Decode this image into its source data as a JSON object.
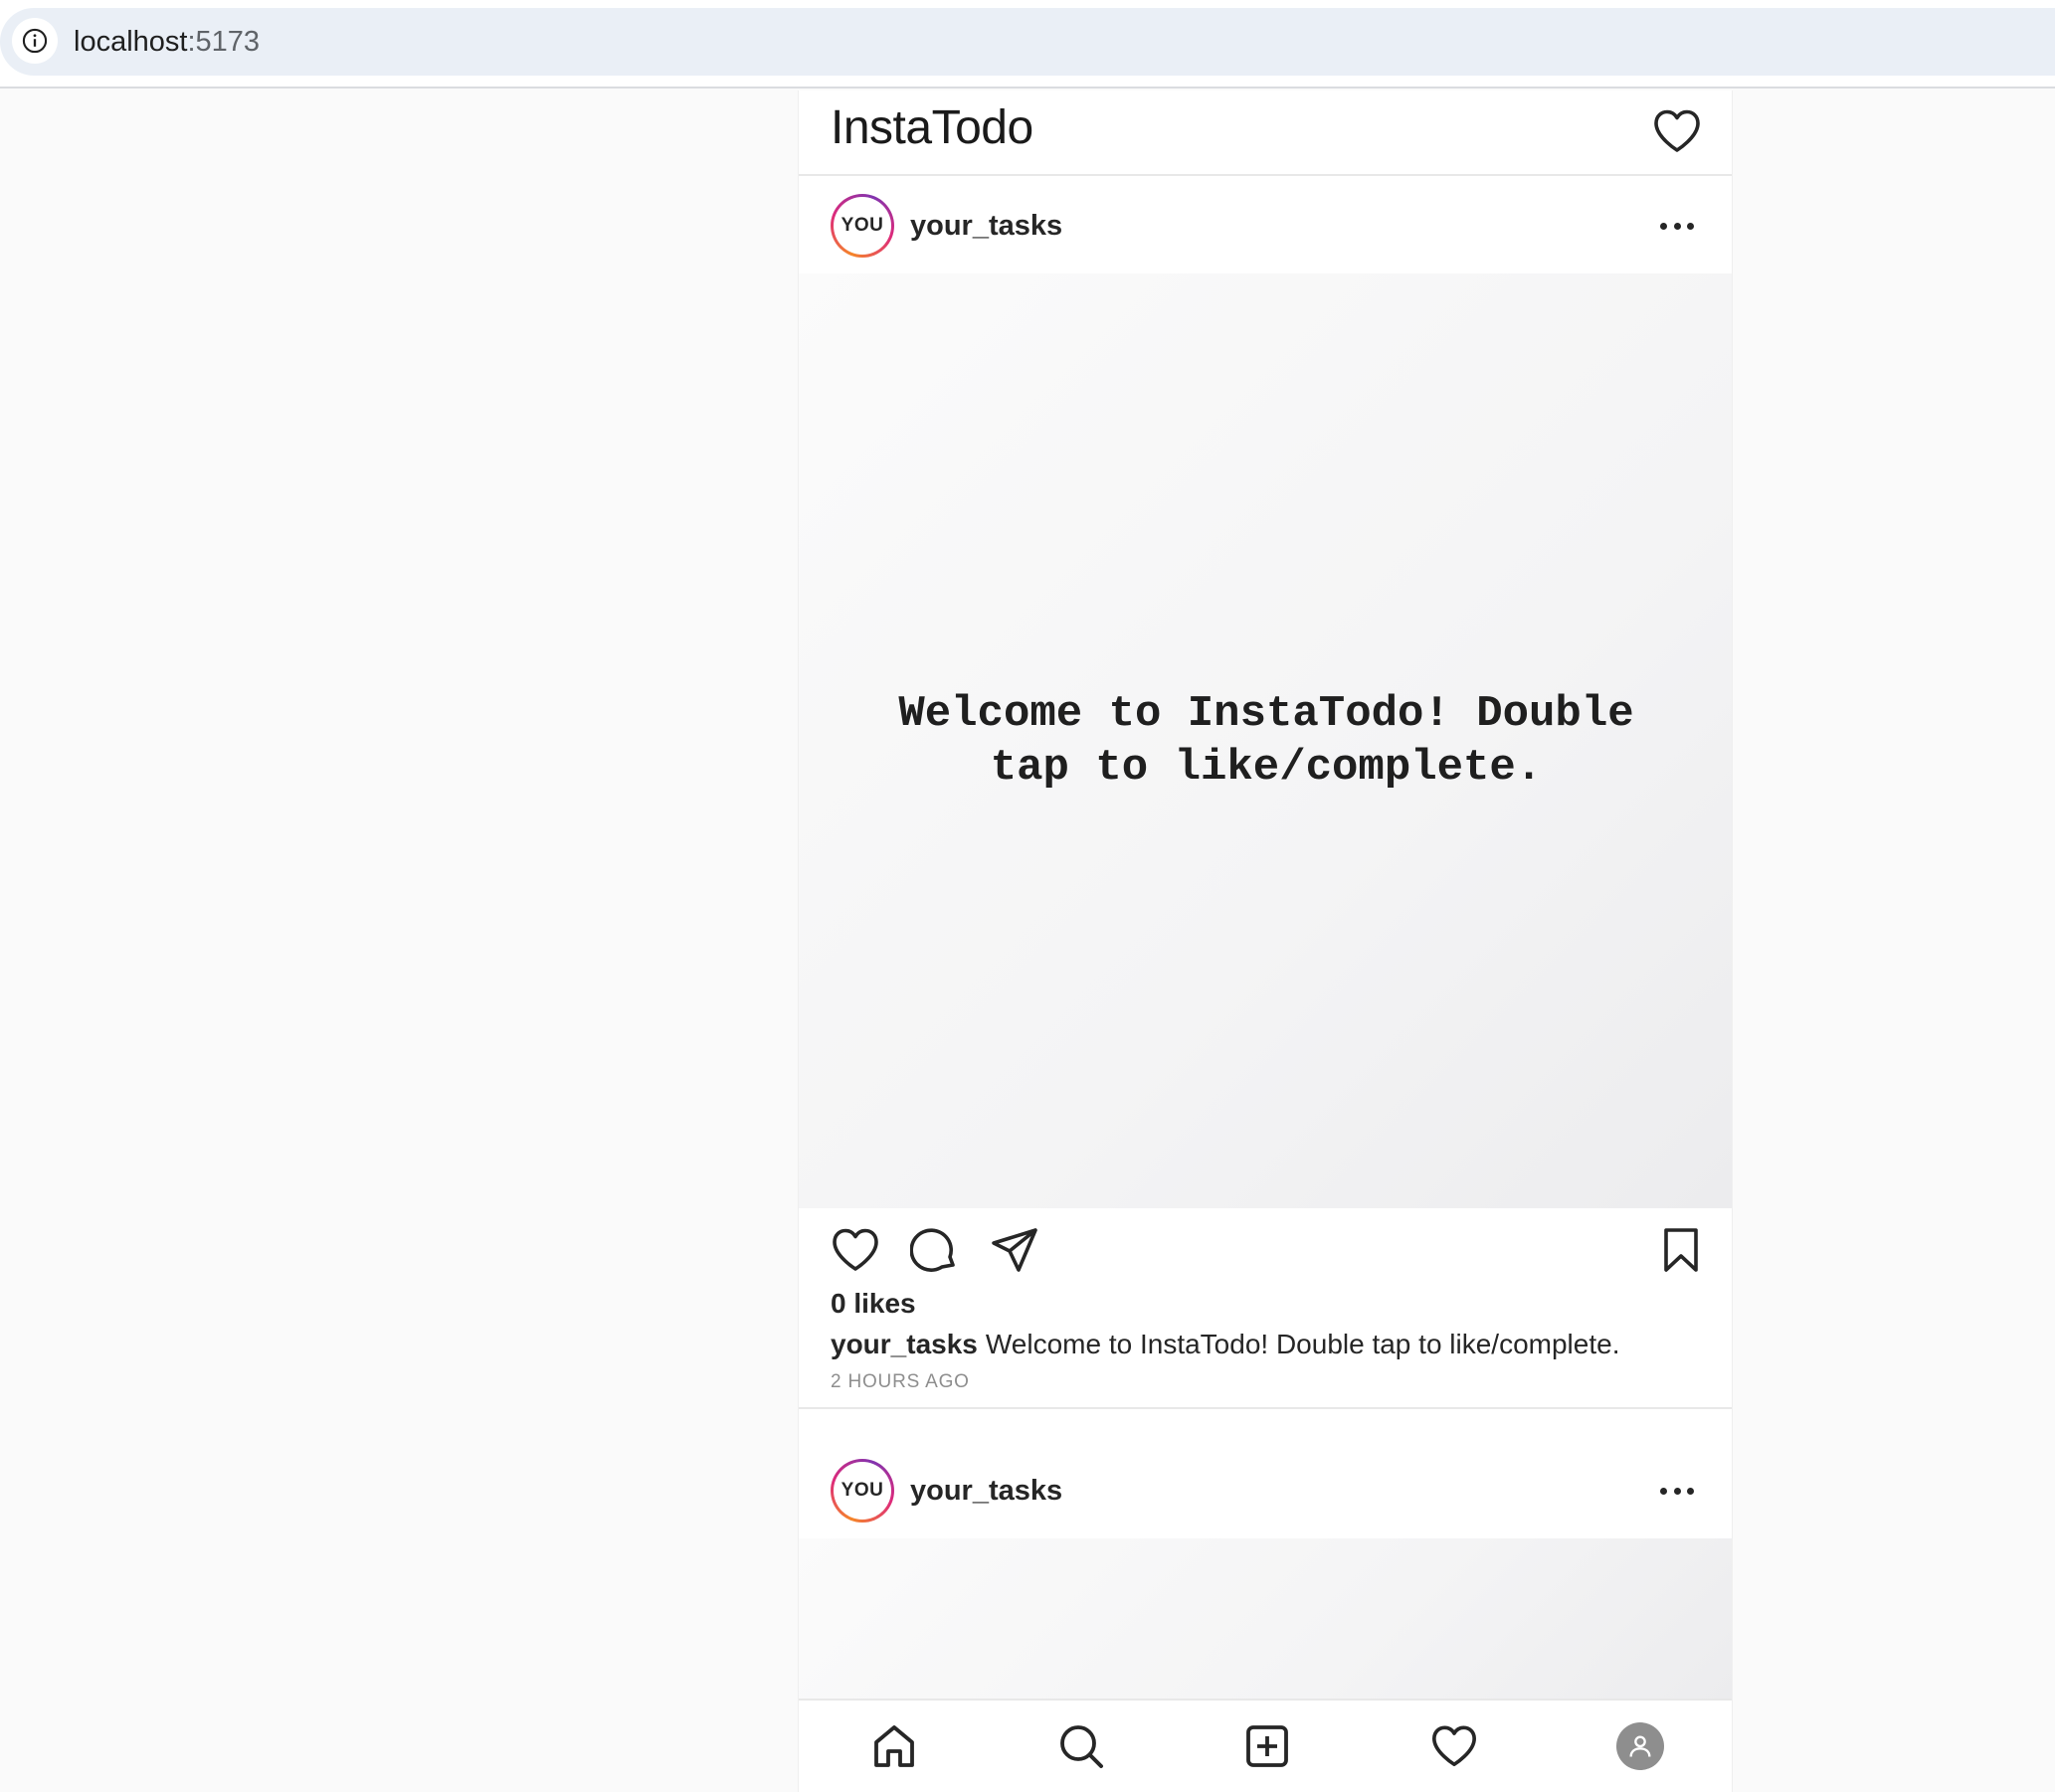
{
  "browser": {
    "url_host": "localhost",
    "url_port": ":5173",
    "info_icon": "info-icon"
  },
  "header": {
    "title": "InstaTodo",
    "activity_icon": "heart-icon"
  },
  "posts": [
    {
      "avatar_text": "YOU",
      "username": "your_tasks",
      "more_icon": "more-horizontal-icon",
      "media_text": "Welcome to InstaTodo! Double tap to like/complete.",
      "likes": "0 likes",
      "caption_user": "your_tasks",
      "caption_text": "Welcome to InstaTodo! Double tap to like/complete.",
      "time_ago": "2 HOURS AGO"
    },
    {
      "avatar_text": "YOU",
      "username": "your_tasks",
      "more_icon": "more-horizontal-icon"
    }
  ],
  "actions": {
    "like_icon": "heart-icon",
    "comment_icon": "comment-icon",
    "share_icon": "send-icon",
    "save_icon": "bookmark-icon"
  },
  "bottom_nav": [
    {
      "icon": "home-icon"
    },
    {
      "icon": "search-icon"
    },
    {
      "icon": "add-post-icon"
    },
    {
      "icon": "heart-icon"
    },
    {
      "icon": "profile-avatar-icon"
    }
  ],
  "colors": {
    "text": "#262626",
    "muted": "#8e8e8e",
    "page_bg": "#fafafa",
    "url_bar": "#eaeff6",
    "avatar_ring": [
      "#f58529",
      "#dd2a7b",
      "#8134af"
    ]
  }
}
